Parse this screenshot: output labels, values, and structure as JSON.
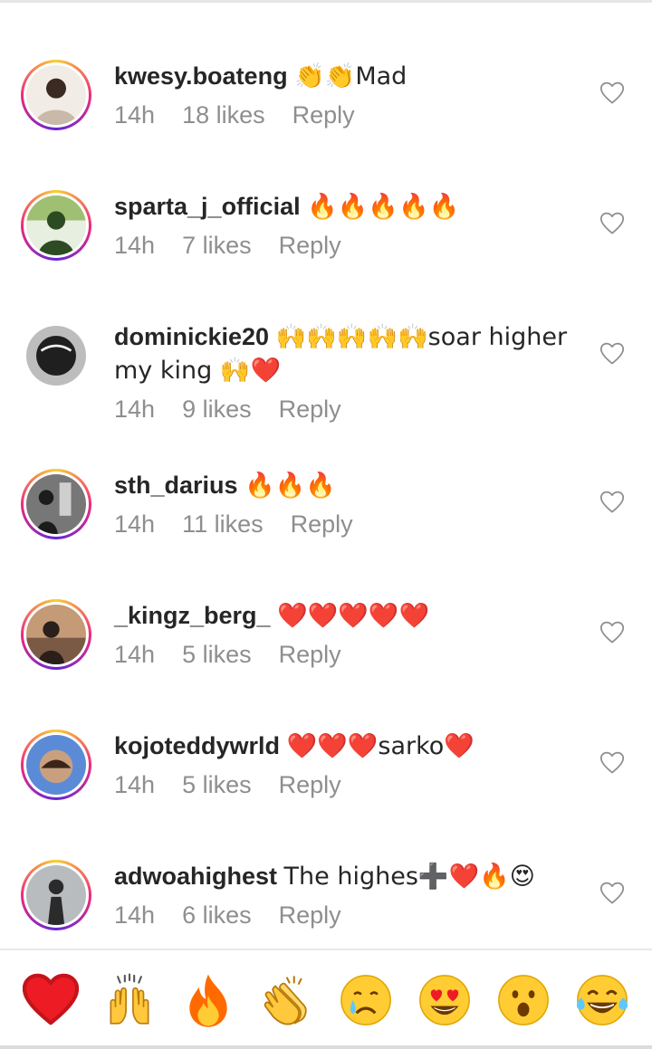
{
  "comments": [
    {
      "username": "kwesy.boateng",
      "text": "👏👏Mad",
      "time": "14h",
      "likes": "18 likes",
      "reply": "Reply",
      "ring": true,
      "avatar_colors": [
        "#c9b9a8",
        "#3b2a22",
        "#f1ece6"
      ]
    },
    {
      "username": "sparta_j_official",
      "text": "🔥🔥🔥🔥🔥",
      "time": "14h",
      "likes": "7 likes",
      "reply": "Reply",
      "ring": true,
      "avatar_colors": [
        "#9fbf72",
        "#2d4b22",
        "#e6efe0"
      ]
    },
    {
      "username": "dominickie20",
      "text": "🙌🙌🙌🙌🙌soar higher my king 🙌❤️",
      "time": "14h",
      "likes": "9 likes",
      "reply": "Reply",
      "ring": false,
      "avatar_colors": [
        "#efefef",
        "#1f1f1f",
        "#bdbdbd"
      ]
    },
    {
      "username": "sth_darius",
      "text": "🔥🔥🔥",
      "time": "14h",
      "likes": "11 likes",
      "reply": "Reply",
      "ring": true,
      "avatar_colors": [
        "#1c1c1c",
        "#777777",
        "#cfcfcf"
      ]
    },
    {
      "username": "_kingz_berg_",
      "text": "❤️❤️❤️❤️❤️",
      "time": "14h",
      "likes": "5 likes",
      "reply": "Reply",
      "ring": true,
      "avatar_colors": [
        "#7a5a45",
        "#2a1f1a",
        "#c49a77"
      ]
    },
    {
      "username": "kojoteddywrld",
      "text": "❤️❤️❤️sarko❤️",
      "time": "14h",
      "likes": "5 likes",
      "reply": "Reply",
      "ring": true,
      "avatar_colors": [
        "#5b8bd6",
        "#3b2418",
        "#c8a080"
      ]
    },
    {
      "username": "adwoahighest",
      "text": "The highes➕❤️🔥😍",
      "time": "14h",
      "likes": "6 likes",
      "reply": "Reply",
      "ring": true,
      "avatar_colors": [
        "#9aa0a6",
        "#2b2b2b",
        "#d9d9d9"
      ]
    }
  ],
  "reactions": [
    {
      "name": "red-heart",
      "glyph": "❤️"
    },
    {
      "name": "raising-hands",
      "glyph": "🙌"
    },
    {
      "name": "fire",
      "glyph": "🔥"
    },
    {
      "name": "clapping-hands",
      "glyph": "👏"
    },
    {
      "name": "crying-face",
      "glyph": "😢"
    },
    {
      "name": "heart-eyes",
      "glyph": "😍"
    },
    {
      "name": "surprised-face",
      "glyph": "😮"
    },
    {
      "name": "tears-of-joy",
      "glyph": "😂"
    }
  ],
  "colors": {
    "text": "#262626",
    "meta": "#8e8e8e",
    "heart_outline": "#8e8e8e",
    "red": "#ed1c24",
    "orange": "#ff7a00",
    "yellow": "#ffcc33"
  }
}
